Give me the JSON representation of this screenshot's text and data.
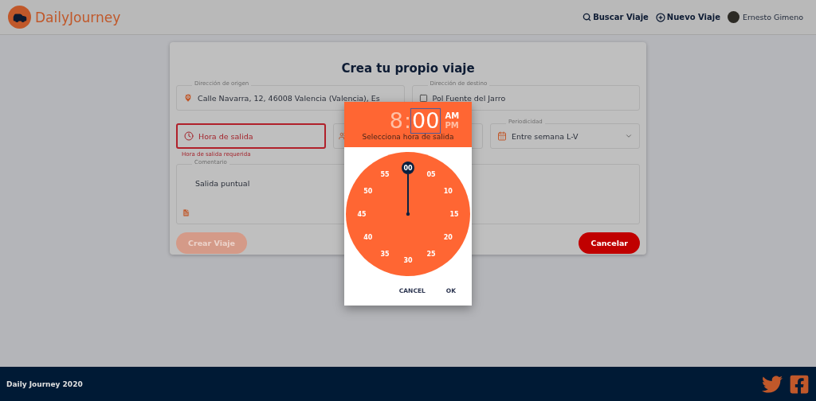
{
  "app": {
    "name": "DailyJourney"
  },
  "nav": [
    {
      "kind": "search",
      "label": "Buscar Viaje"
    },
    {
      "kind": "add",
      "label": "Nuevo Viaje"
    }
  ],
  "user": {
    "name": "Ernesto Gimeno"
  },
  "form": {
    "title": "Crea tu propio viaje",
    "fields": [
      {
        "kind": "origin",
        "label": "Dirección de origen",
        "value": "Calle Navarra, 12, 46008 Valencia (Valencia), Es",
        "error": false
      },
      {
        "kind": "destination",
        "label": "Dirección de destino",
        "value": "Pol Fuente del Jarro",
        "error": false
      },
      {
        "kind": "time",
        "placeholder": "Hora de salida",
        "helper": "Hora de salida requerida",
        "error": true
      },
      {
        "kind": "people",
        "error": false
      },
      {
        "kind": "select",
        "label": "Periodicidad",
        "value": "Entre semana L-V",
        "error": false
      }
    ],
    "comment": {
      "label": "Comentario",
      "value": "Salida puntual"
    },
    "buttons": [
      {
        "kind": "submit",
        "label": "Crear Viaje",
        "disabled": true
      },
      {
        "kind": "cancel",
        "label": "Cancelar",
        "disabled": false
      }
    ]
  },
  "picker": {
    "hour": "8",
    "hour_selected": false,
    "separator": ":",
    "minutes": "00",
    "minutes_selected": true,
    "periods": [
      {
        "label": "AM",
        "selected": true
      },
      {
        "label": "PM",
        "selected": false
      }
    ],
    "caption": "Selecciona hora de salida",
    "dial": [
      {
        "label": "00",
        "selected": true
      },
      {
        "label": "05",
        "selected": false
      },
      {
        "label": "10",
        "selected": false
      },
      {
        "label": "15",
        "selected": false
      },
      {
        "label": "20",
        "selected": false
      },
      {
        "label": "25",
        "selected": false
      },
      {
        "label": "30",
        "selected": false
      },
      {
        "label": "35",
        "selected": false
      },
      {
        "label": "40",
        "selected": false
      },
      {
        "label": "45",
        "selected": false
      },
      {
        "label": "50",
        "selected": false
      },
      {
        "label": "55",
        "selected": false
      }
    ],
    "actions": [
      "CANCEL",
      "OK"
    ]
  },
  "footer": {
    "text": "Daily Journey 2020"
  }
}
